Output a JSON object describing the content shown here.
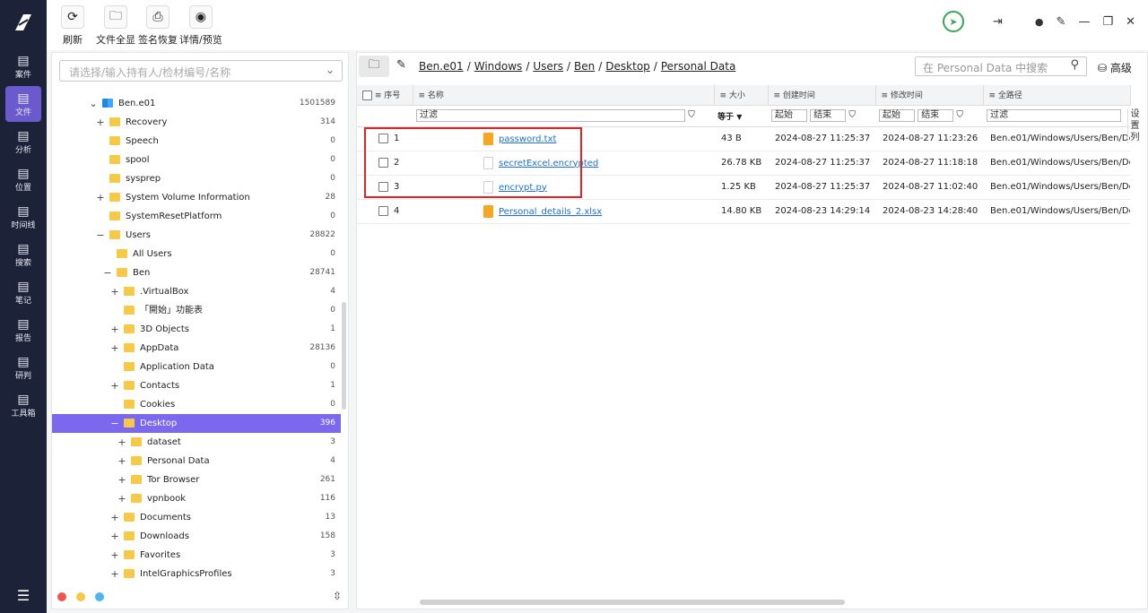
{
  "rail": {
    "items": [
      {
        "label": "案件",
        "icon": "case-icon"
      },
      {
        "label": "文件",
        "icon": "file-icon"
      },
      {
        "label": "分析",
        "icon": "analysis-icon"
      },
      {
        "label": "位置",
        "icon": "location-icon"
      },
      {
        "label": "时间线",
        "icon": "timeline-icon"
      },
      {
        "label": "搜索",
        "icon": "search-icon"
      },
      {
        "label": "笔记",
        "icon": "note-icon"
      },
      {
        "label": "报告",
        "icon": "report-icon"
      },
      {
        "label": "研判",
        "icon": "judge-icon"
      },
      {
        "label": "工具箱",
        "icon": "toolbox-icon"
      }
    ],
    "active_index": 1
  },
  "toolbar": {
    "refresh": "刷新",
    "show_all": "文件全显",
    "sig_recover": "签名恢复",
    "detail_preview": "详情/预览"
  },
  "tree": {
    "search_placeholder": "请选择/输入持有人/检材编号/名称",
    "nodes": [
      {
        "label": "Ben.e01",
        "count": "1501589",
        "exp": "⌄",
        "level": 0,
        "icon": "windows"
      },
      {
        "label": "Recovery",
        "count": "314",
        "exp": "+",
        "level": 1
      },
      {
        "label": "Speech",
        "count": "0",
        "exp": "",
        "level": 1
      },
      {
        "label": "spool",
        "count": "0",
        "exp": "",
        "level": 1
      },
      {
        "label": "sysprep",
        "count": "0",
        "exp": "",
        "level": 1
      },
      {
        "label": "System Volume Information",
        "count": "28",
        "exp": "+",
        "level": 1
      },
      {
        "label": "SystemResetPlatform",
        "count": "0",
        "exp": "",
        "level": 1
      },
      {
        "label": "Users",
        "count": "28822",
        "exp": "−",
        "level": 1
      },
      {
        "label": "All Users",
        "count": "0",
        "exp": "",
        "level": 2
      },
      {
        "label": "Ben",
        "count": "28741",
        "exp": "−",
        "level": 2
      },
      {
        "label": ".VirtualBox",
        "count": "4",
        "exp": "+",
        "level": 3
      },
      {
        "label": "「開始」功能表",
        "count": "0",
        "exp": "",
        "level": 3
      },
      {
        "label": "3D Objects",
        "count": "1",
        "exp": "+",
        "level": 3
      },
      {
        "label": "AppData",
        "count": "28136",
        "exp": "+",
        "level": 3
      },
      {
        "label": "Application Data",
        "count": "0",
        "exp": "",
        "level": 3
      },
      {
        "label": "Contacts",
        "count": "1",
        "exp": "+",
        "level": 3
      },
      {
        "label": "Cookies",
        "count": "0",
        "exp": "",
        "level": 3
      },
      {
        "label": "Desktop",
        "count": "396",
        "exp": "−",
        "level": 3,
        "selected": true
      },
      {
        "label": "dataset",
        "count": "3",
        "exp": "+",
        "level": 4
      },
      {
        "label": "Personal Data",
        "count": "4",
        "exp": "+",
        "level": 4
      },
      {
        "label": "Tor Browser",
        "count": "261",
        "exp": "+",
        "level": 4
      },
      {
        "label": "vpnbook",
        "count": "116",
        "exp": "+",
        "level": 4
      },
      {
        "label": "Documents",
        "count": "13",
        "exp": "+",
        "level": 3
      },
      {
        "label": "Downloads",
        "count": "158",
        "exp": "+",
        "level": 3
      },
      {
        "label": "Favorites",
        "count": "3",
        "exp": "+",
        "level": 3
      },
      {
        "label": "IntelGraphicsProfiles",
        "count": "3",
        "exp": "+",
        "level": 3
      }
    ]
  },
  "breadcrumb": [
    "Ben.e01",
    "Windows",
    "Users",
    "Ben",
    "Desktop",
    "Personal Data"
  ],
  "breadcrumb_sep": "/",
  "file_search_placeholder": "在 Personal Data 中搜索",
  "advanced_label": "高级",
  "side_tab_label": "设置列",
  "columns": {
    "index": "序号",
    "name": "名称",
    "size": "大小",
    "created": "创建时间",
    "modified": "修改时间",
    "path": "全路径"
  },
  "filters": {
    "name": "过滤",
    "size_op": "等于",
    "created_start": "起始",
    "created_end": "结束",
    "modified_start": "起始",
    "modified_end": "结束",
    "path": "过滤"
  },
  "rows": [
    {
      "index": "1",
      "name": "password.txt",
      "type": "txt",
      "size": "43 B",
      "created": "2024-08-27 11:25:37",
      "modified": "2024-08-27 11:23:26",
      "path": "Ben.e01/Windows/Users/Ben/De"
    },
    {
      "index": "2",
      "name": "secretExcel.encrypted",
      "type": "blank",
      "size": "26.78 KB",
      "created": "2024-08-27 11:25:37",
      "modified": "2024-08-27 11:18:18",
      "path": "Ben.e01/Windows/Users/Ben/De"
    },
    {
      "index": "3",
      "name": "encrypt.py",
      "type": "blank",
      "size": "1.25 KB",
      "created": "2024-08-27 11:25:37",
      "modified": "2024-08-27 11:02:40",
      "path": "Ben.e01/Windows/Users/Ben/De"
    },
    {
      "index": "4",
      "name": "Personal_details_2.xlsx",
      "type": "xlsx",
      "size": "14.80 KB",
      "created": "2024-08-23 14:29:14",
      "modified": "2024-08-23 14:28:40",
      "path": "Ben.e01/Windows/Users/Ben/De"
    }
  ],
  "colors": {
    "accent": "#7b68ee",
    "rail": "#1c2238",
    "highlight": "#e02424",
    "link": "#1e6fd9"
  }
}
